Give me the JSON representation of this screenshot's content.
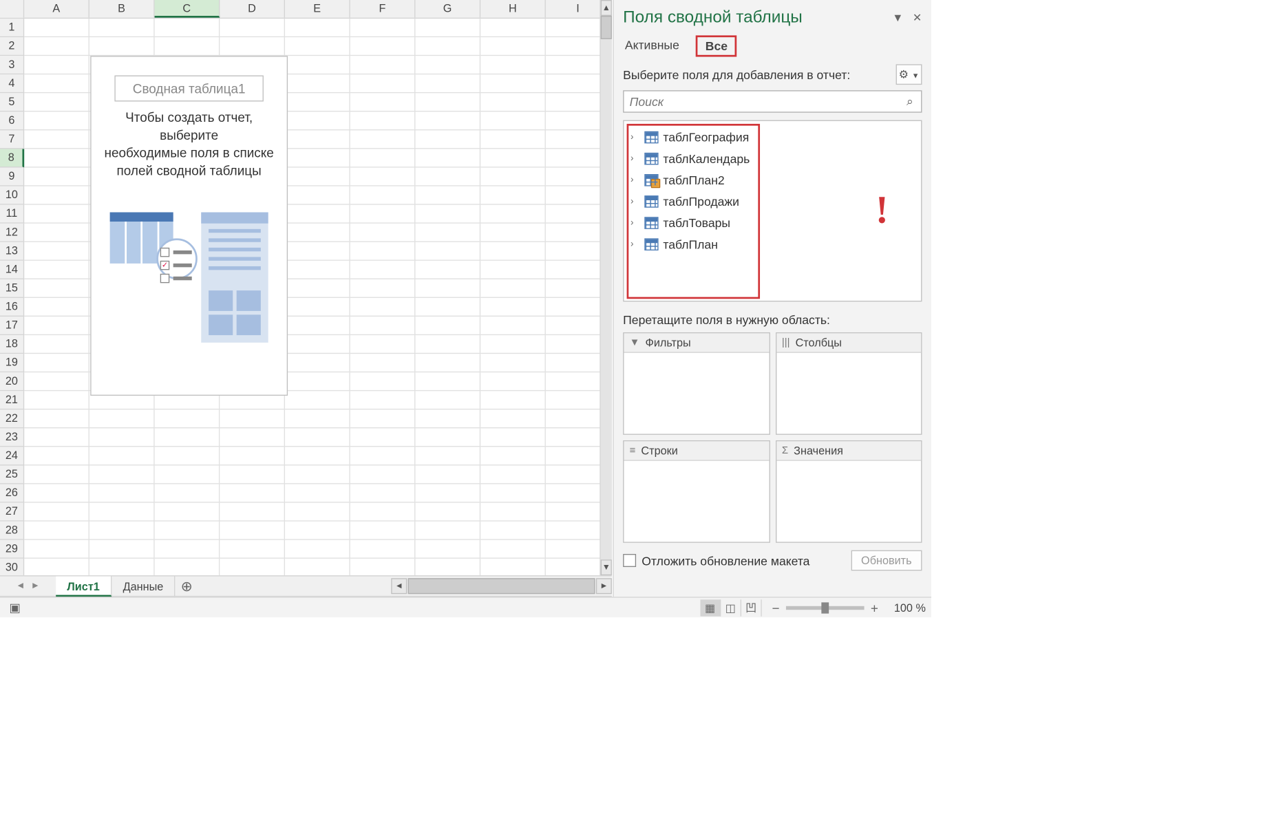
{
  "grid": {
    "columns": [
      "A",
      "B",
      "C",
      "D",
      "E",
      "F",
      "G",
      "H",
      "I"
    ],
    "rows": 30,
    "selected_col": "C",
    "selected_row": 8
  },
  "pivot_placeholder": {
    "title": "Сводная таблица1",
    "instruction_l1": "Чтобы создать отчет, выберите",
    "instruction_l2": "необходимые поля в списке",
    "instruction_l3": "полей сводной таблицы"
  },
  "sheet_tabs": {
    "tabs": [
      {
        "name": "Лист1",
        "active": true
      },
      {
        "name": "Данные",
        "active": false
      }
    ],
    "add_label": "⊕"
  },
  "pane": {
    "title": "Поля сводной таблицы",
    "tabs": {
      "active": "Активные",
      "all": "Все"
    },
    "select_prompt": "Выберите поля для добавления в отчет:",
    "search_placeholder": "Поиск",
    "fields": [
      {
        "name": "таблГеография",
        "special": false
      },
      {
        "name": "таблКалендарь",
        "special": false
      },
      {
        "name": "таблПлан2",
        "special": true
      },
      {
        "name": "таблПродажи",
        "special": false
      },
      {
        "name": "таблТовары",
        "special": false
      },
      {
        "name": "таблПлан",
        "special": false
      }
    ],
    "exclaim": "!",
    "drag_prompt": "Перетащите поля в нужную область:",
    "zones": {
      "filters": "Фильтры",
      "columns": "Столбцы",
      "rows": "Строки",
      "values": "Значения"
    },
    "footer": {
      "defer_label": "Отложить обновление макета",
      "update_btn": "Обновить"
    }
  },
  "status": {
    "zoom": "100 %"
  }
}
